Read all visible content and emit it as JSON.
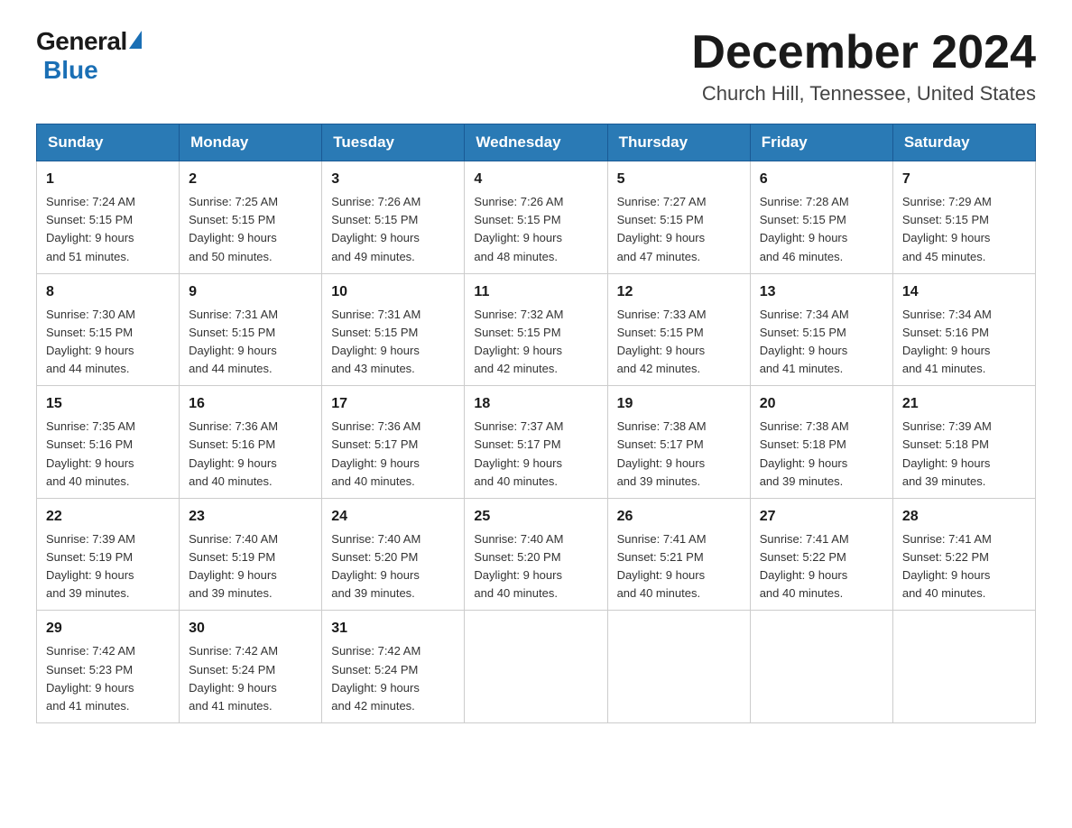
{
  "logo": {
    "general": "General",
    "blue": "Blue"
  },
  "header": {
    "month": "December 2024",
    "location": "Church Hill, Tennessee, United States"
  },
  "weekdays": [
    "Sunday",
    "Monday",
    "Tuesday",
    "Wednesday",
    "Thursday",
    "Friday",
    "Saturday"
  ],
  "weeks": [
    [
      {
        "day": "1",
        "sunrise": "7:24 AM",
        "sunset": "5:15 PM",
        "daylight": "9 hours and 51 minutes."
      },
      {
        "day": "2",
        "sunrise": "7:25 AM",
        "sunset": "5:15 PM",
        "daylight": "9 hours and 50 minutes."
      },
      {
        "day": "3",
        "sunrise": "7:26 AM",
        "sunset": "5:15 PM",
        "daylight": "9 hours and 49 minutes."
      },
      {
        "day": "4",
        "sunrise": "7:26 AM",
        "sunset": "5:15 PM",
        "daylight": "9 hours and 48 minutes."
      },
      {
        "day": "5",
        "sunrise": "7:27 AM",
        "sunset": "5:15 PM",
        "daylight": "9 hours and 47 minutes."
      },
      {
        "day": "6",
        "sunrise": "7:28 AM",
        "sunset": "5:15 PM",
        "daylight": "9 hours and 46 minutes."
      },
      {
        "day": "7",
        "sunrise": "7:29 AM",
        "sunset": "5:15 PM",
        "daylight": "9 hours and 45 minutes."
      }
    ],
    [
      {
        "day": "8",
        "sunrise": "7:30 AM",
        "sunset": "5:15 PM",
        "daylight": "9 hours and 44 minutes."
      },
      {
        "day": "9",
        "sunrise": "7:31 AM",
        "sunset": "5:15 PM",
        "daylight": "9 hours and 44 minutes."
      },
      {
        "day": "10",
        "sunrise": "7:31 AM",
        "sunset": "5:15 PM",
        "daylight": "9 hours and 43 minutes."
      },
      {
        "day": "11",
        "sunrise": "7:32 AM",
        "sunset": "5:15 PM",
        "daylight": "9 hours and 42 minutes."
      },
      {
        "day": "12",
        "sunrise": "7:33 AM",
        "sunset": "5:15 PM",
        "daylight": "9 hours and 42 minutes."
      },
      {
        "day": "13",
        "sunrise": "7:34 AM",
        "sunset": "5:15 PM",
        "daylight": "9 hours and 41 minutes."
      },
      {
        "day": "14",
        "sunrise": "7:34 AM",
        "sunset": "5:16 PM",
        "daylight": "9 hours and 41 minutes."
      }
    ],
    [
      {
        "day": "15",
        "sunrise": "7:35 AM",
        "sunset": "5:16 PM",
        "daylight": "9 hours and 40 minutes."
      },
      {
        "day": "16",
        "sunrise": "7:36 AM",
        "sunset": "5:16 PM",
        "daylight": "9 hours and 40 minutes."
      },
      {
        "day": "17",
        "sunrise": "7:36 AM",
        "sunset": "5:17 PM",
        "daylight": "9 hours and 40 minutes."
      },
      {
        "day": "18",
        "sunrise": "7:37 AM",
        "sunset": "5:17 PM",
        "daylight": "9 hours and 40 minutes."
      },
      {
        "day": "19",
        "sunrise": "7:38 AM",
        "sunset": "5:17 PM",
        "daylight": "9 hours and 39 minutes."
      },
      {
        "day": "20",
        "sunrise": "7:38 AM",
        "sunset": "5:18 PM",
        "daylight": "9 hours and 39 minutes."
      },
      {
        "day": "21",
        "sunrise": "7:39 AM",
        "sunset": "5:18 PM",
        "daylight": "9 hours and 39 minutes."
      }
    ],
    [
      {
        "day": "22",
        "sunrise": "7:39 AM",
        "sunset": "5:19 PM",
        "daylight": "9 hours and 39 minutes."
      },
      {
        "day": "23",
        "sunrise": "7:40 AM",
        "sunset": "5:19 PM",
        "daylight": "9 hours and 39 minutes."
      },
      {
        "day": "24",
        "sunrise": "7:40 AM",
        "sunset": "5:20 PM",
        "daylight": "9 hours and 39 minutes."
      },
      {
        "day": "25",
        "sunrise": "7:40 AM",
        "sunset": "5:20 PM",
        "daylight": "9 hours and 40 minutes."
      },
      {
        "day": "26",
        "sunrise": "7:41 AM",
        "sunset": "5:21 PM",
        "daylight": "9 hours and 40 minutes."
      },
      {
        "day": "27",
        "sunrise": "7:41 AM",
        "sunset": "5:22 PM",
        "daylight": "9 hours and 40 minutes."
      },
      {
        "day": "28",
        "sunrise": "7:41 AM",
        "sunset": "5:22 PM",
        "daylight": "9 hours and 40 minutes."
      }
    ],
    [
      {
        "day": "29",
        "sunrise": "7:42 AM",
        "sunset": "5:23 PM",
        "daylight": "9 hours and 41 minutes."
      },
      {
        "day": "30",
        "sunrise": "7:42 AM",
        "sunset": "5:24 PM",
        "daylight": "9 hours and 41 minutes."
      },
      {
        "day": "31",
        "sunrise": "7:42 AM",
        "sunset": "5:24 PM",
        "daylight": "9 hours and 42 minutes."
      },
      null,
      null,
      null,
      null
    ]
  ],
  "labels": {
    "sunrise": "Sunrise:",
    "sunset": "Sunset:",
    "daylight": "Daylight:"
  }
}
